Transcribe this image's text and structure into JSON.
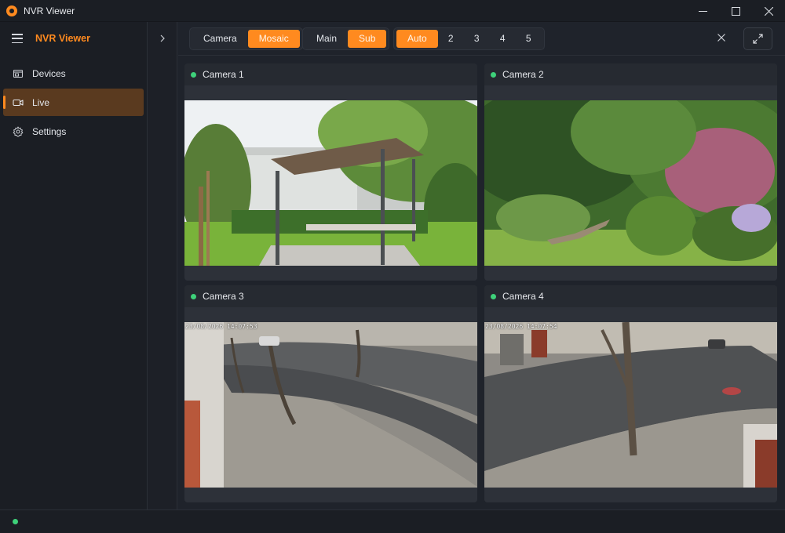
{
  "window": {
    "title": "NVR Viewer"
  },
  "sidebar": {
    "title": "NVR Viewer",
    "items": [
      {
        "label": "Devices",
        "icon": "devices-icon",
        "active": false
      },
      {
        "label": "Live",
        "icon": "video-camera-icon",
        "active": true
      },
      {
        "label": "Settings",
        "icon": "gear-icon",
        "active": false
      }
    ]
  },
  "toolbar": {
    "view_mode": [
      "Camera",
      "Mosaic"
    ],
    "view_mode_selected": "Mosaic",
    "stream": [
      "Main",
      "Sub"
    ],
    "stream_selected": "Sub",
    "layout": [
      "Auto",
      "2",
      "3",
      "4",
      "5"
    ],
    "layout_selected": "Auto"
  },
  "cameras": [
    {
      "name": "Camera 1",
      "status": "online",
      "scene": "garden-pergola"
    },
    {
      "name": "Camera 2",
      "status": "online",
      "scene": "garden-steps"
    },
    {
      "name": "Camera 3",
      "status": "online",
      "scene": "street-fisheye",
      "osd": "23/08/2026 14:07:53"
    },
    {
      "name": "Camera 4",
      "status": "online",
      "scene": "street-fisheye",
      "osd": "23/08/2026 14:07:54"
    }
  ],
  "colors": {
    "accent": "#ff8a1f",
    "online": "#3ed17a",
    "background": "#1f232b"
  }
}
